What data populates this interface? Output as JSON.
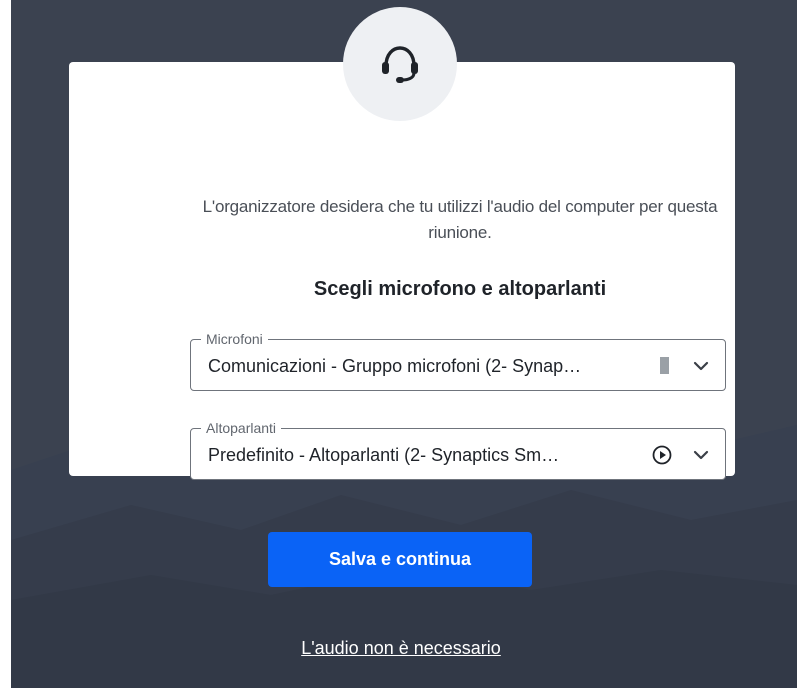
{
  "dialog": {
    "message": "L'organizzatore desidera che tu utilizzi l'audio del computer per questa riunione.",
    "heading": "Scegli microfono e altoparlanti"
  },
  "microphone": {
    "label": "Microfoni",
    "value": "Comunicazioni - Gruppo microfoni (2- Synap…"
  },
  "speaker": {
    "label": "Altoparlanti",
    "value": "Predefinito - Altoparlanti (2- Synaptics Sm…"
  },
  "actions": {
    "save_label": "Salva e continua",
    "skip_label": "L'audio non è necessario"
  },
  "colors": {
    "background": "#3b4250",
    "primary": "#0a63f6",
    "card": "#ffffff"
  },
  "icons": {
    "header": "headset-icon",
    "dropdown": "chevron-down-icon",
    "test_speaker": "play-circle-icon"
  }
}
